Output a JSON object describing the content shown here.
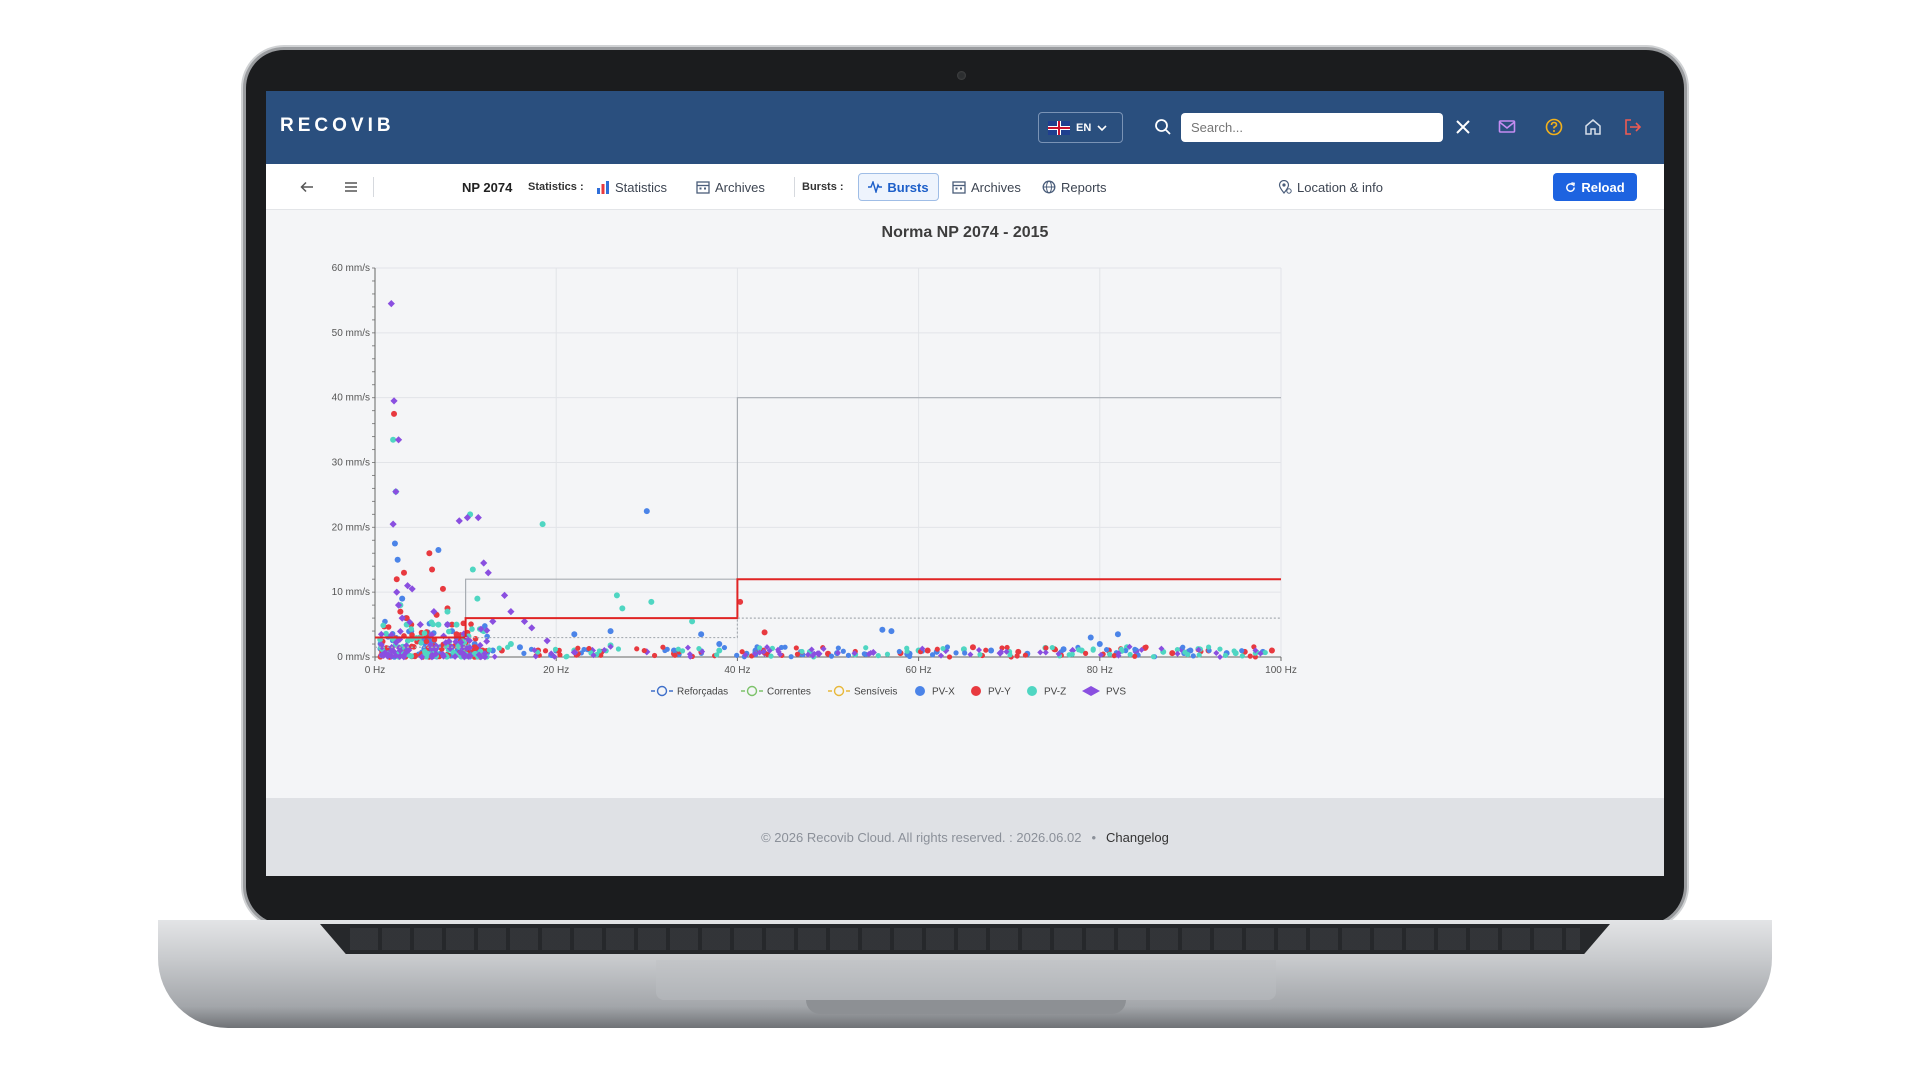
{
  "app": {
    "brand": "RECOVIB",
    "language": "EN",
    "search_placeholder": "Search..."
  },
  "subbar": {
    "device": "NP 2074",
    "statistics_label": "Statistics :",
    "statistics_link": "Statistics",
    "archives_link_1": "Archives",
    "bursts_label": "Bursts :",
    "bursts_link": "Bursts",
    "archives_link_2": "Archives",
    "reports_link": "Reports",
    "location_link": "Location & info",
    "reload_label": "Reload"
  },
  "footer": {
    "copyright": "© 2026 Recovib Cloud. All rights reserved. : 2026.06.02",
    "separator": "•",
    "changelog": "Changelog"
  },
  "colors": {
    "header_bg": "#2a4f7e",
    "primary_button": "#1d63e0",
    "pv_x": "#4b84e8",
    "pv_y": "#e8393f",
    "pv_z": "#4fd6c2",
    "pvs": "#8a4fe0",
    "limit_red": "#e02424",
    "limit_gray": "#a8adb3"
  },
  "chart_data": {
    "type": "scatter",
    "title": "Norma NP 2074 - 2015",
    "xlim": [
      0,
      100
    ],
    "ylim": [
      0,
      60
    ],
    "x_ticks": [
      "0 Hz",
      "20 Hz",
      "40 Hz",
      "60 Hz",
      "80 Hz",
      "100 Hz"
    ],
    "y_ticks": [
      "0 mm/s",
      "10 mm/s",
      "20 mm/s",
      "30 mm/s",
      "40 mm/s",
      "50 mm/s",
      "60 mm/s"
    ],
    "legend_position": "bottom",
    "limit_lines": [
      {
        "name": "Reforçadas",
        "color": "#a8adb3",
        "style": "solid",
        "steps": [
          [
            0,
            3
          ],
          [
            10,
            3
          ],
          [
            10,
            12
          ],
          [
            40,
            12
          ],
          [
            40,
            40
          ],
          [
            100,
            40
          ]
        ]
      },
      {
        "name": "Correntes",
        "color": "#e02424",
        "style": "solid",
        "steps": [
          [
            0,
            3
          ],
          [
            10,
            3
          ],
          [
            10,
            6
          ],
          [
            40,
            6
          ],
          [
            40,
            12
          ],
          [
            100,
            12
          ]
        ]
      },
      {
        "name": "Sensíveis",
        "color": "#a8adb3",
        "style": "dashed",
        "steps": [
          [
            0,
            1.5
          ],
          [
            10,
            1.5
          ],
          [
            10,
            3
          ],
          [
            40,
            3
          ],
          [
            40,
            6
          ],
          [
            100,
            6
          ]
        ]
      }
    ],
    "legend": [
      "Reforçadas",
      "Correntes",
      "Sensíveis",
      "PV-X",
      "PV-Y",
      "PV-Z",
      "PVS"
    ],
    "series": [
      {
        "name": "PV-X",
        "color": "#4b84e8",
        "marker": "circle",
        "points": [
          [
            2.2,
            17.5
          ],
          [
            2.5,
            15
          ],
          [
            3,
            9
          ],
          [
            3.4,
            6
          ],
          [
            4,
            4
          ],
          [
            5,
            3
          ],
          [
            6,
            2.5
          ],
          [
            7,
            16.5
          ],
          [
            8,
            5
          ],
          [
            8.5,
            4
          ],
          [
            9,
            3
          ],
          [
            9.5,
            2
          ],
          [
            10,
            1.5
          ],
          [
            11,
            2
          ],
          [
            13,
            1
          ],
          [
            16,
            1.5
          ],
          [
            20,
            1
          ],
          [
            22,
            3.5
          ],
          [
            26,
            4
          ],
          [
            30,
            22.5
          ],
          [
            33,
            1
          ],
          [
            36,
            3.5
          ],
          [
            38,
            2
          ],
          [
            42,
            1
          ],
          [
            47,
            0.5
          ],
          [
            51,
            0.6
          ],
          [
            56,
            4.2
          ],
          [
            57,
            4
          ],
          [
            59,
            0.5
          ],
          [
            62,
            0.8
          ],
          [
            68,
            1
          ],
          [
            72,
            0.5
          ],
          [
            76,
            1.2
          ],
          [
            79,
            3
          ],
          [
            80,
            2
          ],
          [
            82,
            3.5
          ],
          [
            84,
            1
          ],
          [
            90,
            1
          ],
          [
            94,
            0.6
          ],
          [
            98,
            0.8
          ]
        ]
      },
      {
        "name": "PV-Y",
        "color": "#e8393f",
        "marker": "circle",
        "points": [
          [
            2.1,
            37.5
          ],
          [
            2.4,
            12
          ],
          [
            2.8,
            7
          ],
          [
            3.2,
            13
          ],
          [
            3.5,
            6
          ],
          [
            4,
            5
          ],
          [
            5,
            3
          ],
          [
            6,
            16
          ],
          [
            6.3,
            13.5
          ],
          [
            6.8,
            6.5
          ],
          [
            7.5,
            10.5
          ],
          [
            8,
            7.5
          ],
          [
            8.5,
            5
          ],
          [
            9,
            3.5
          ],
          [
            9.5,
            2.5
          ],
          [
            10,
            2
          ],
          [
            11,
            1.5
          ],
          [
            14,
            1
          ],
          [
            18,
            1
          ],
          [
            25,
            0.8
          ],
          [
            33,
            0.5
          ],
          [
            40.3,
            8.5
          ],
          [
            42,
            0.6
          ],
          [
            43,
            3.8
          ],
          [
            50,
            0.5
          ],
          [
            58,
            0.6
          ],
          [
            61,
            1
          ],
          [
            66,
            1.5
          ],
          [
            71,
            0.8
          ],
          [
            75,
            1.2
          ],
          [
            81,
            1
          ],
          [
            85,
            1.4
          ],
          [
            88,
            0.6
          ],
          [
            92,
            1
          ],
          [
            96,
            0.8
          ],
          [
            99,
            1
          ]
        ]
      },
      {
        "name": "PV-Z",
        "color": "#4fd6c2",
        "marker": "circle",
        "points": [
          [
            2,
            33.5
          ],
          [
            2.3,
            25.5
          ],
          [
            2.8,
            8
          ],
          [
            3.5,
            5
          ],
          [
            5,
            3
          ],
          [
            7,
            5
          ],
          [
            8,
            7
          ],
          [
            9,
            5
          ],
          [
            10.5,
            22
          ],
          [
            10.8,
            13.5
          ],
          [
            11.3,
            9
          ],
          [
            12,
            4
          ],
          [
            15,
            2
          ],
          [
            18.5,
            20.5
          ],
          [
            22,
            1
          ],
          [
            26,
            1.8
          ],
          [
            26.7,
            9.5
          ],
          [
            27.3,
            7.5
          ],
          [
            30.5,
            8.5
          ],
          [
            35,
            5.5
          ],
          [
            38,
            1
          ],
          [
            41,
            0.5
          ],
          [
            48,
            0.8
          ],
          [
            53,
            0.4
          ],
          [
            60,
            1
          ],
          [
            65,
            1.2
          ],
          [
            70,
            0.8
          ],
          [
            74,
            1.4
          ],
          [
            78,
            1
          ],
          [
            83,
            1.5
          ],
          [
            87,
            0.8
          ],
          [
            91,
            1.2
          ],
          [
            95,
            0.6
          ]
        ]
      },
      {
        "name": "PVS",
        "color": "#8a4fe0",
        "marker": "diamond",
        "points": [
          [
            1.8,
            54.5
          ],
          [
            2.1,
            39.5
          ],
          [
            2.6,
            33.5
          ],
          [
            2.3,
            25.5
          ],
          [
            2.0,
            20.5
          ],
          [
            2.4,
            10
          ],
          [
            2.6,
            8
          ],
          [
            3,
            6
          ],
          [
            3.6,
            11
          ],
          [
            4.1,
            10.5
          ],
          [
            5,
            5
          ],
          [
            6.5,
            7
          ],
          [
            8,
            5
          ],
          [
            9.3,
            21
          ],
          [
            10.2,
            21.5
          ],
          [
            11.4,
            21.5
          ],
          [
            12,
            14.5
          ],
          [
            12.5,
            13
          ],
          [
            13,
            5.5
          ],
          [
            14.3,
            9.5
          ],
          [
            15,
            7
          ],
          [
            16.5,
            5.5
          ],
          [
            17.3,
            4.5
          ],
          [
            19,
            2.5
          ],
          [
            24,
            1
          ],
          [
            30,
            0.8
          ],
          [
            43,
            0.6
          ],
          [
            49,
            0.5
          ],
          [
            55,
            0.7
          ],
          [
            63,
            1
          ],
          [
            69,
            0.6
          ],
          [
            77,
            1
          ],
          [
            84,
            0.8
          ],
          [
            89,
            1.2
          ]
        ]
      }
    ]
  }
}
